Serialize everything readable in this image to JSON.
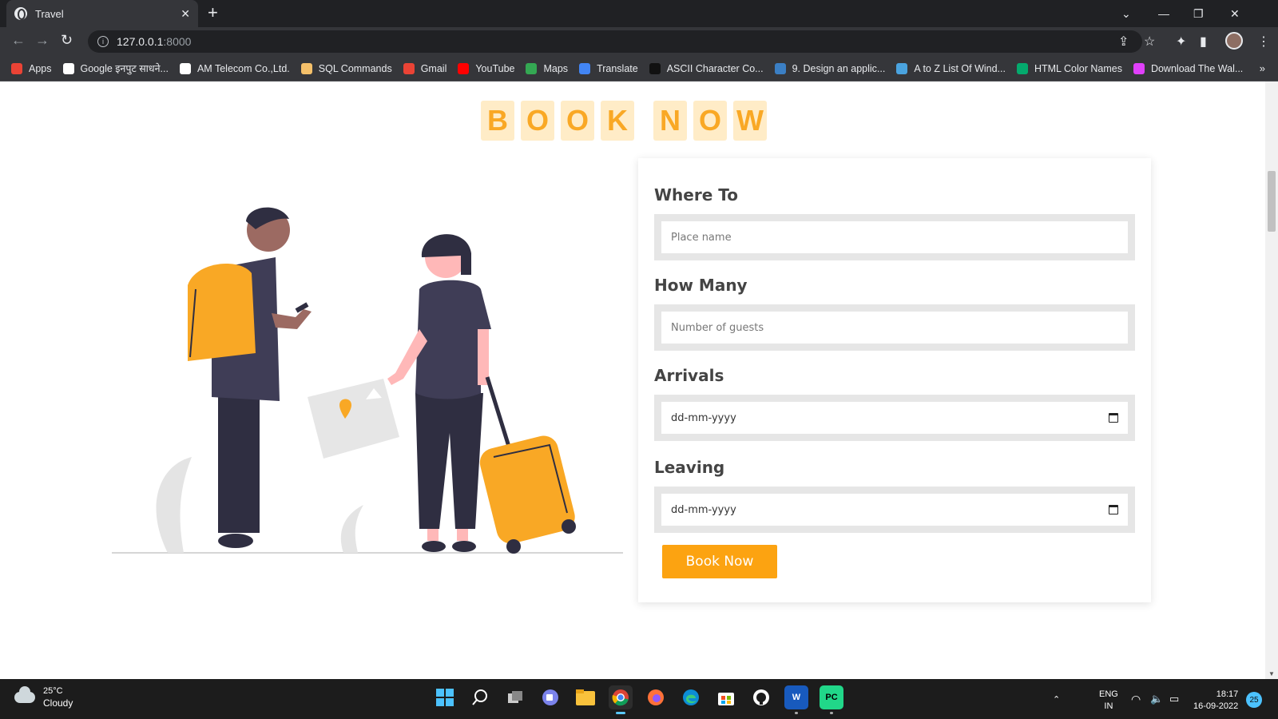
{
  "browser": {
    "tab_title": "Travel",
    "tab_close": "✕",
    "new_tab": "+",
    "url_host": "127.0.0.1",
    "url_port": ":8000",
    "window_controls": [
      "⌄",
      "—",
      "❐",
      "✕"
    ]
  },
  "bookmarks": [
    {
      "label": "Apps",
      "color": "#ea4335"
    },
    {
      "label": "Google इनपुट साधने...",
      "color": "#ffffff"
    },
    {
      "label": "AM Telecom Co.,Ltd.",
      "color": "#ffffff"
    },
    {
      "label": "SQL Commands",
      "color": "#f4c06a"
    },
    {
      "label": "Gmail",
      "color": "#ea4335"
    },
    {
      "label": "YouTube",
      "color": "#ff0000"
    },
    {
      "label": "Maps",
      "color": "#34a853"
    },
    {
      "label": "Translate",
      "color": "#4285f4"
    },
    {
      "label": "ASCII Character Co...",
      "color": "#111111"
    },
    {
      "label": "9. Design an applic...",
      "color": "#3b7fc4"
    },
    {
      "label": "A to Z List Of Wind...",
      "color": "#4aa3df"
    },
    {
      "label": "HTML Color Names",
      "color": "#04aa6d"
    },
    {
      "label": "Download The Wal...",
      "color": "#e040fb"
    }
  ],
  "bookmarks_more": "»",
  "page": {
    "heading_word1": [
      "B",
      "O",
      "O",
      "K"
    ],
    "heading_word2": [
      "N",
      "O",
      "W"
    ],
    "form": {
      "where_label": "Where To",
      "where_placeholder": "Place name",
      "how_many_label": "How Many",
      "how_many_placeholder": "Number of guests",
      "arrivals_label": "Arrivals",
      "arrivals_value": "dd-mm-yyyy",
      "leaving_label": "Leaving",
      "leaving_value": "dd-mm-yyyy",
      "submit_label": "Book Now"
    },
    "accent_color": "#fca311",
    "heading_bg": "#ffecc7"
  },
  "taskbar": {
    "temperature": "25°C",
    "weather": "Cloudy",
    "lang_top": "ENG",
    "lang_bottom": "IN",
    "time": "18:17",
    "date": "16-09-2022",
    "notification_count": "25",
    "icons": [
      "windows-start-icon",
      "search-icon",
      "task-view-icon",
      "teams-chat-icon",
      "file-explorer-icon",
      "chrome-icon",
      "firefox-icon",
      "edge-icon",
      "microsoft-store-icon",
      "github-icon",
      "word-icon",
      "pycharm-icon"
    ]
  }
}
